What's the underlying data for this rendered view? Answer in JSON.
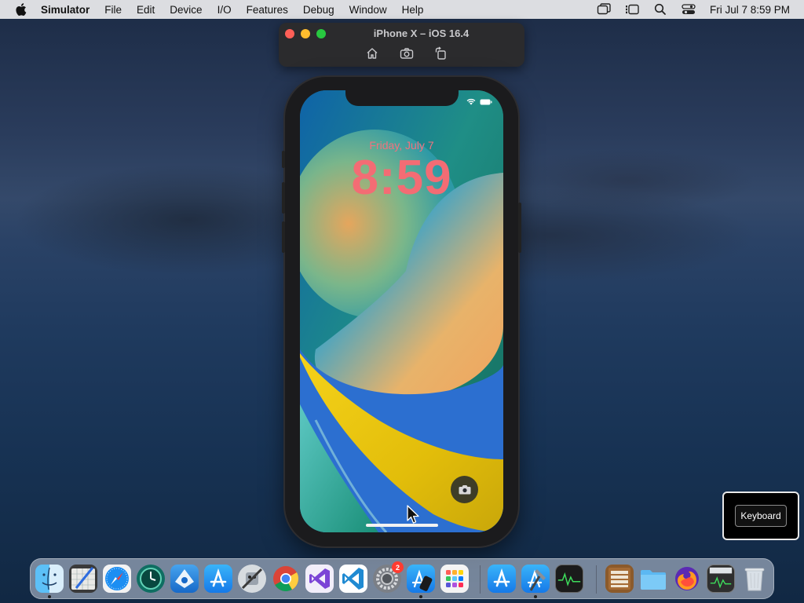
{
  "menubar": {
    "app_name": "Simulator",
    "items": [
      "File",
      "Edit",
      "Device",
      "I/O",
      "Features",
      "Debug",
      "Window",
      "Help"
    ],
    "clock": "Fri Jul 7  8:59 PM"
  },
  "simulator": {
    "title": "iPhone X – iOS 16.4"
  },
  "lockscreen": {
    "date": "Friday, July 7",
    "time": "8:59"
  },
  "keyboard_hud": {
    "label": "Keyboard"
  },
  "dock": {
    "notification_badge": "2",
    "apps": [
      "finder",
      "grapher",
      "safari",
      "time-machine",
      "instruments",
      "app-store-connect",
      "automator",
      "chrome",
      "visual-studio",
      "vscode",
      "system-preferences",
      "simulator",
      "launchpad",
      "app-store",
      "xcode",
      "activity-monitor",
      "archive-utility",
      "downloads-folder",
      "firefox",
      "console",
      "trash"
    ]
  },
  "colors": {
    "menubar_bg": "#dcdde1",
    "lock_time": "#f36c74",
    "accent_blue": "#2f7cf6"
  }
}
